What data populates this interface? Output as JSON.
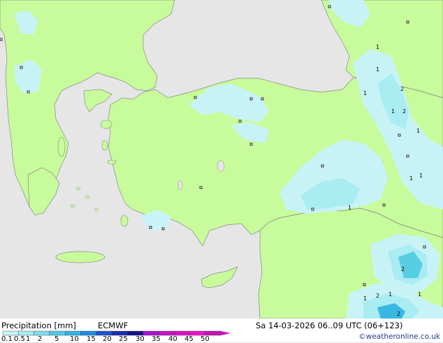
{
  "title_left": "Precipitation [mm]",
  "model": "ECMWF",
  "valid_time": "Sa 14-03-2026 06..09 UTC (06+123)",
  "credit": "©weatheronline.co.uk",
  "legend": {
    "levels": [
      "0.1",
      "0.5",
      "1",
      "2",
      "5",
      "10",
      "15",
      "20",
      "25",
      "30",
      "35",
      "40",
      "45",
      "50"
    ],
    "colors": [
      "#c9f3fb",
      "#a8ecf7",
      "#7ddcef",
      "#51cbe6",
      "#32b5e6",
      "#1c8fe0",
      "#2250d6",
      "#1b2cb6",
      "#15118b",
      "#ab13d1",
      "#cb10cf",
      "#de0fce",
      "#ef12c7",
      "#c814b5"
    ]
  },
  "map_colors": {
    "land": "#c8fb9b",
    "sea": "#e6e6e6",
    "coast": "#888888",
    "precip_light": "#c9f3fb",
    "precip_mid": "#a8ecf7",
    "precip_heavy": "#51cbe6",
    "precip_strong": "#32b5e6"
  },
  "map_labels": [
    "1",
    "1",
    "1",
    "2",
    "1",
    "2",
    "1",
    "1",
    "1",
    "2",
    "1",
    "1",
    "2",
    "2",
    "1",
    "1"
  ]
}
